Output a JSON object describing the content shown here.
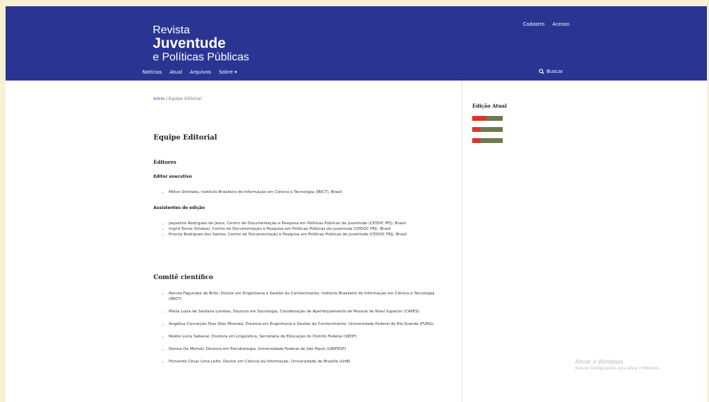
{
  "header": {
    "logo_line1": "Revista",
    "logo_line2": "Juventude",
    "logo_line3": "e Políticas Públicas",
    "user_links": [
      "Cadastro",
      "Acesso"
    ],
    "nav": [
      "Notícias",
      "Atual",
      "Arquivos",
      "Sobre ▾"
    ],
    "search_label": "Buscar"
  },
  "breadcrumb": {
    "home": "Início",
    "separator": "/",
    "current": "Equipe Editorial"
  },
  "main": {
    "title": "Equipe Editorial",
    "editores_heading": "Editores",
    "editor_executivo_heading": "Editor executivo",
    "editor_executivo": [
      "Milton Shintaku, Instituto Brasileiro de Informação em Ciência e Tecnologia (IBICT), Brasil"
    ],
    "assistentes_heading": "Assistentes de edição",
    "assistentes": [
      "Jaqueline Rodrigues de Jesus, Centro de Documentação e Pesquisa em Políticas Públicas de Juventude (CEDOC PPJ), Brasil",
      "Ingrid Torres Schiessl, Centro de Documentação e Pesquisa em Políticas Públicas de Juventude (CEDOC PPJ), Brasil",
      "Priscila Rodrigues dos Santos, Centro de Documentação e Pesquisa em Políticas Públicas de Juventude (CEDOC PPJ), Brasil"
    ],
    "comite_heading": "Comitê científico",
    "comite": [
      "Ronnie Fagundes de Brito, Doutor em Engenharia e Gestão do Conhecimento, Instituto Brasileiro de Informação em Ciência e Tecnologia (IBICT)",
      "Maria Luiza de Santana Lombas, Doutora em Sociologia, Coordenação de Aperfeiçoamento de Pessoal de Nível Superior (CAPES)",
      "Angélica Conceição Dias Dias Miranda, Doutora em Engenharia e Gestão do Conhecimento, Universidade Federal do Rio Grande (FURG)",
      "Noêlio Lúcia Sabanai, Doutora em Linguística, Secretaria de Educação do Distrito Federal (SEDF)",
      "Denise De Micheli, Doutora em Psicobiologia, Universidade Federal de São Paulo (UNIFESP)",
      "Fernando César Lima Leite, Doutor em Ciência da Informação, Universidade de Brasília (UnB)"
    ]
  },
  "sidebar": {
    "title": "Edição Atual"
  },
  "watermark": {
    "line1": "Ativar o Windows",
    "line2": "Acesse Configurações para ativar o Windows."
  },
  "colors": {
    "header_bg": "#2a3593",
    "page_bg": "#f7f0d2",
    "badge_red": "#d9352a",
    "badge_olive": "#6f7a4e"
  }
}
